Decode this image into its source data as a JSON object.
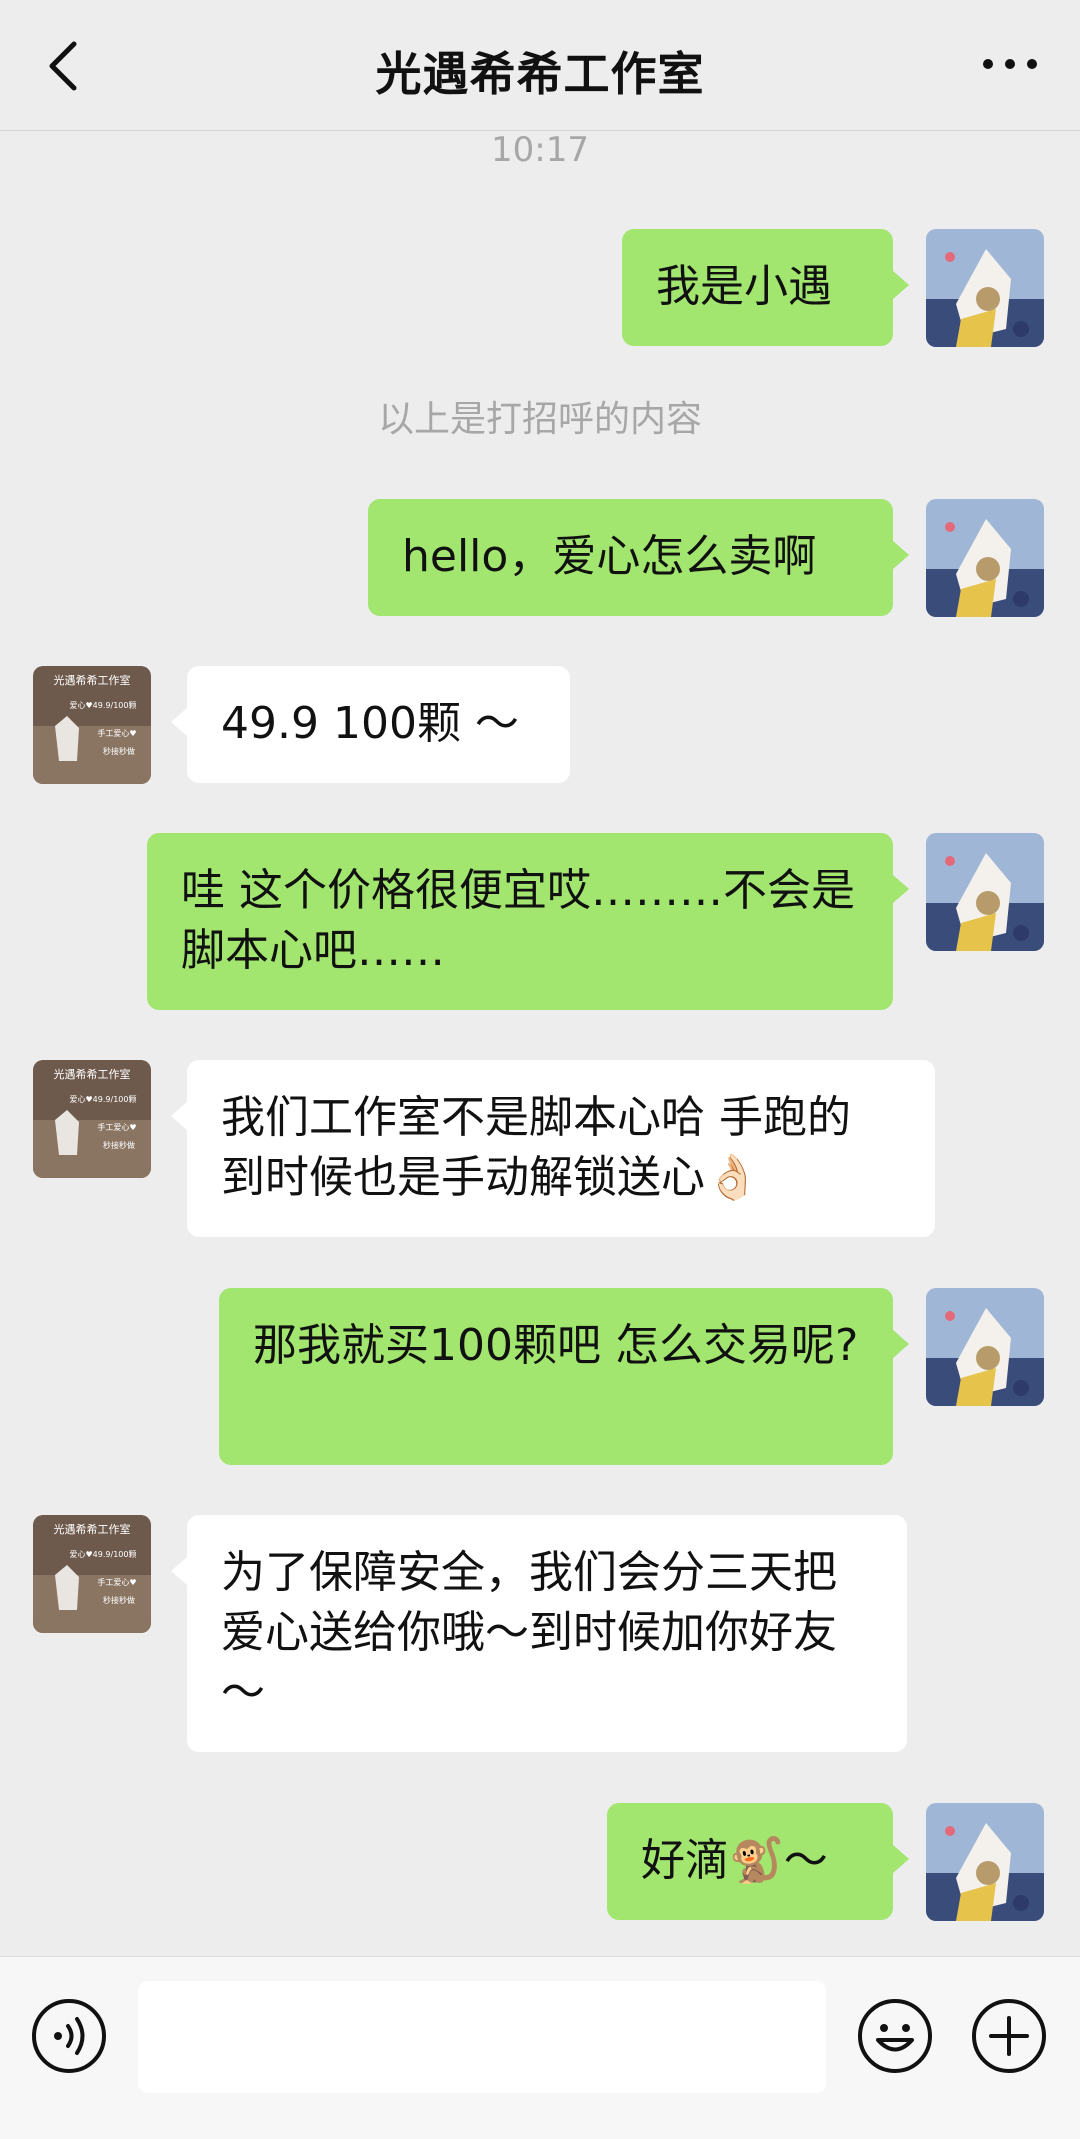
{
  "header": {
    "title": "光遇希希工作室",
    "back_icon": "chevron-left-icon",
    "more_icon": "more-dots-icon"
  },
  "chat": {
    "time": "10:17",
    "system_note": "以上是打招呼的内容",
    "messages": [
      {
        "from": "me",
        "text": "我是小遇"
      },
      {
        "from": "me",
        "text": "hello，爱心怎么卖啊"
      },
      {
        "from": "shop",
        "text": "49.9 100颗 ～"
      },
      {
        "from": "me",
        "text": "哇 这个价格很便宜哎………不会是脚本心吧……"
      },
      {
        "from": "shop",
        "text": "我们工作室不是脚本心哈 手跑的 到时候也是手动解锁送心👌🏻"
      },
      {
        "from": "me",
        "text": "那我就买100颗吧 怎么交易呢?"
      },
      {
        "from": "shop",
        "text": "为了保障安全，我们会分三天把爱心送给你哦～到时候加你好友～"
      },
      {
        "from": "me",
        "text": "好滴🐒～"
      }
    ],
    "shop_avatar_lines": [
      "光遇希希工作室",
      "爱心♥49.9/100颗",
      "手工爱心♥",
      "秒接秒做"
    ]
  },
  "input_bar": {
    "voice_icon": "voice-icon",
    "emoji_icon": "emoji-icon",
    "plus_icon": "plus-icon",
    "input_value": ""
  },
  "colors": {
    "me_bubble": "#a2e66f",
    "shop_bubble": "#ffffff",
    "background": "#ededed"
  }
}
